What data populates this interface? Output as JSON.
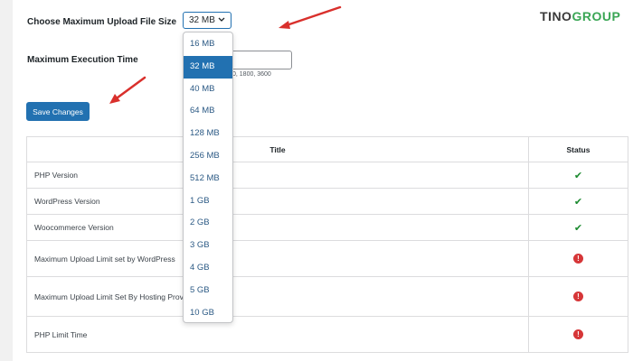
{
  "brand": {
    "name_main": "TINO",
    "name_accent": "GROUP"
  },
  "form": {
    "upload_label": "Choose Maximum Upload File Size",
    "upload_value": "32 MB",
    "upload_options": [
      "16 MB",
      "32 MB",
      "40 MB",
      "64 MB",
      "128 MB",
      "256 MB",
      "512 MB",
      "1 GB",
      "2 GB",
      "3 GB",
      "4 GB",
      "5 GB",
      "10 GB"
    ],
    "upload_selected": "32 MB",
    "exec_label": "Maximum Execution Time",
    "exec_value": "",
    "exec_hint_visible": "0, 1800, 3600",
    "save_label": "Save Changes"
  },
  "table": {
    "headers": {
      "title": "Title",
      "status": "Status"
    },
    "rows": [
      {
        "title": "PHP Version",
        "status": "ok"
      },
      {
        "title": "WordPress Version",
        "status": "ok"
      },
      {
        "title": "Woocommerce Version",
        "status": "ok"
      },
      {
        "title": "Maximum Upload Limit set by WordPress",
        "status": "warn"
      },
      {
        "title": "Maximum Upload Limit Set By Hosting Provider",
        "status": "warn"
      },
      {
        "title": "PHP Limit Time",
        "status": "warn"
      }
    ]
  },
  "icons": {
    "ok": "✔",
    "warn": "!"
  },
  "colors": {
    "accent": "#2271b1",
    "ok": "#1a8a2e",
    "warn": "#d63638",
    "arrow": "#d9302c",
    "brand_green": "#3aa655"
  }
}
